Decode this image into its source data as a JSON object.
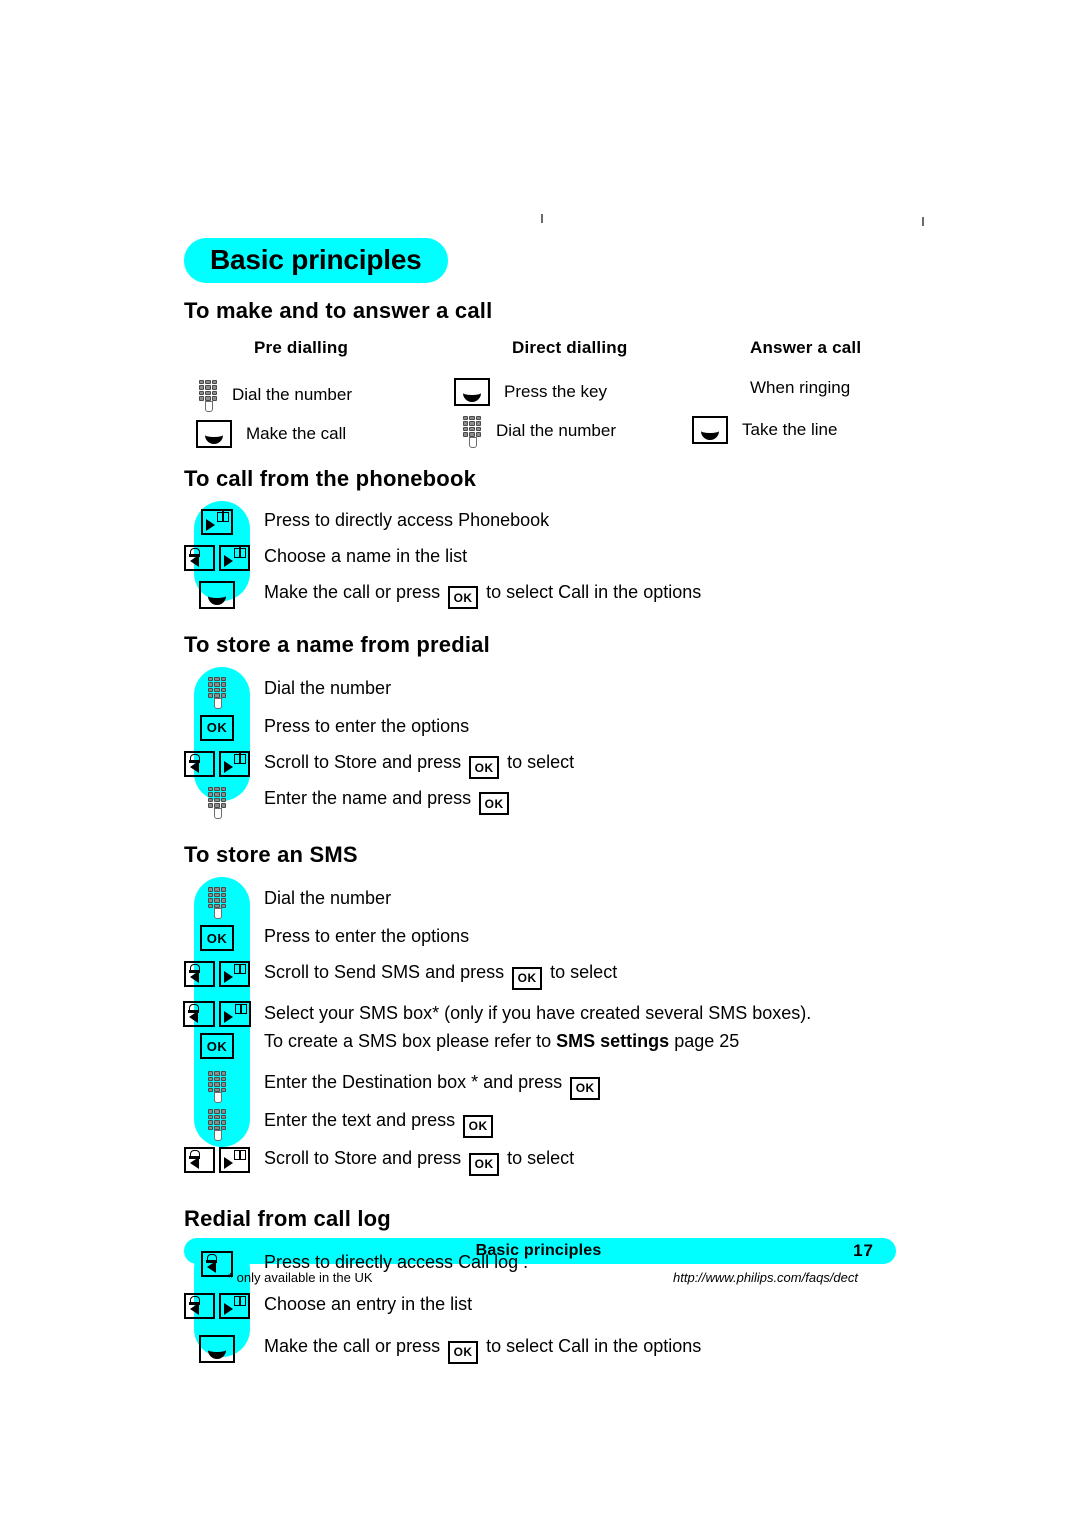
{
  "chapter": {
    "badge": "Basic principles"
  },
  "sections": [
    {
      "id": "make-answer",
      "title": "To make and to answer a call",
      "columns": [
        {
          "head": "Pre dialling",
          "rows": [
            {
              "icon": "keypad-icon",
              "text": "Dial the number"
            },
            {
              "icon": "handset-key-icon",
              "text": "Make the call"
            }
          ]
        },
        {
          "head": "Direct dialling",
          "rows": [
            {
              "icon": "handset-key-icon",
              "text": "Press the key"
            },
            {
              "icon": "keypad-icon",
              "text": "Dial the number"
            }
          ]
        },
        {
          "head": "Answer a call",
          "rows": [
            {
              "icon": "none",
              "text": "When ringing"
            },
            {
              "icon": "handset-key-icon",
              "text": "Take the line"
            }
          ]
        }
      ]
    },
    {
      "id": "call-from-phonebook",
      "title": "To call from the phonebook",
      "steps": [
        {
          "icons": [
            "nav-right-phonebook-icon"
          ],
          "text": "Press to directly access Phonebook"
        },
        {
          "icons": [
            "nav-left-calllog-icon",
            "nav-right-phonebook-icon"
          ],
          "text": "Choose a name in the list"
        },
        {
          "icons": [
            "handset-key-icon"
          ],
          "text_before": "Make the call or press",
          "inline_key": "OK",
          "text_after": "to select Call in the options"
        }
      ]
    },
    {
      "id": "store-name-from-predial",
      "title": "To store a name from predial",
      "steps": [
        {
          "icons": [
            "keypad-icon"
          ],
          "text": "Dial the number"
        },
        {
          "icons": [
            "ok-key-icon"
          ],
          "text": "Press to enter the options"
        },
        {
          "icons": [
            "nav-left-calllog-icon",
            "nav-right-phonebook-icon"
          ],
          "text_before": "Scroll to Store   and press",
          "inline_key": "OK",
          "text_after": "to select"
        },
        {
          "icons": [
            "keypad-icon"
          ],
          "text_before": "Enter the name and press",
          "inline_key": "OK",
          "text_after": ""
        }
      ]
    },
    {
      "id": "store-an-sms",
      "title": "To store an SMS",
      "steps": [
        {
          "icons": [
            "keypad-icon"
          ],
          "text": "Dial the number"
        },
        {
          "icons": [
            "ok-key-icon"
          ],
          "text": "Press to enter the options"
        },
        {
          "icons": [
            "nav-left-calllog-icon",
            "nav-right-phonebook-icon"
          ],
          "text_before": "Scroll to Send SMS  and press",
          "inline_key": "OK",
          "text_after": "to select"
        },
        {
          "icons": [
            "nav-left-calllog-icon",
            "nav-right-phonebook-icon"
          ],
          "icons2": [
            "ok-key-icon"
          ],
          "para_line1": "Select your SMS box* (only if you have created several SMS boxes).",
          "para_line2_before": "To create a SMS box please refer to ",
          "para_line2_bold": "SMS settings",
          "para_line2_after": " page 25"
        },
        {
          "icons": [
            "keypad-icon"
          ],
          "text_before": "Enter the Destination box   * and press",
          "inline_key": "OK",
          "text_after": ""
        },
        {
          "icons": [
            "keypad-icon"
          ],
          "text_before": "Enter the text and press",
          "inline_key": "OK",
          "text_after": ""
        },
        {
          "icons": [
            "nav-left-calllog-icon",
            "nav-right-phonebook-icon"
          ],
          "text_before": "Scroll to  Store    and press",
          "inline_key": "OK",
          "text_after": "to select"
        }
      ]
    },
    {
      "id": "redial-from-call-log",
      "title": "Redial from call log",
      "steps": [
        {
          "icons": [
            "nav-left-calllog-icon"
          ],
          "text": "Press to directly access Call log  ."
        },
        {
          "icons": [
            "nav-left-calllog-icon",
            "nav-right-phonebook-icon"
          ],
          "text": "Choose an entry in the list"
        },
        {
          "icons": [
            "handset-key-icon"
          ],
          "text_before": "Make the call or press",
          "inline_key": "OK",
          "text_after": "to select Call in the options"
        }
      ]
    }
  ],
  "footer": {
    "title": "Basic principles",
    "page": "17",
    "footnote_left": "* only available in the UK",
    "footnote_right": "http://www.philips.com/faqs/dect"
  },
  "colors": {
    "accent_cyan": "#00ffff",
    "text": "#000000",
    "page_bg": "#ffffff"
  }
}
